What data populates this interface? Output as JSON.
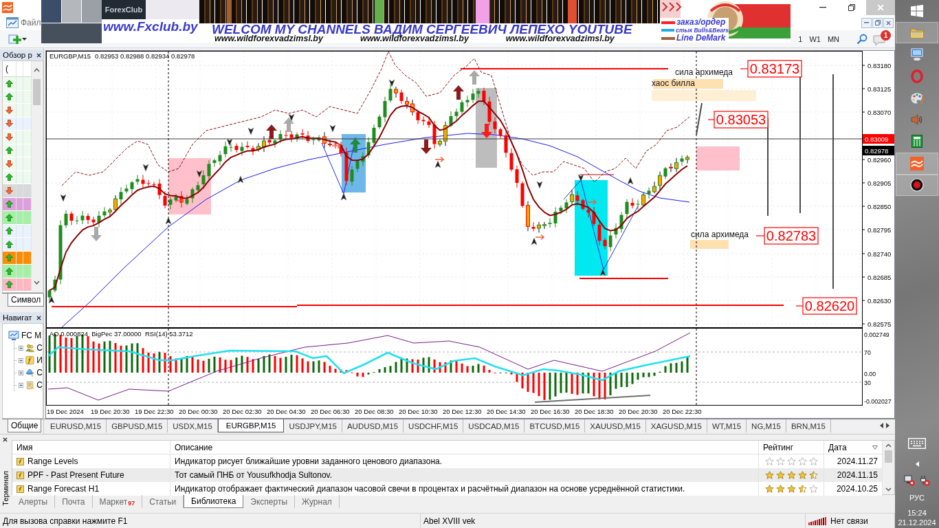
{
  "window": {
    "menu": [
      "Файл"
    ],
    "periods": [
      "1",
      "W1",
      "MN"
    ],
    "notifications": "1"
  },
  "banner": {
    "logo": "ForexClub",
    "site": "www.Fxclub.by",
    "headline": "WELCOM MY CHANNELS ВАДИМ СЕРГЕЕВИЧ ЛЕПЕХО YOUTUBE",
    "links": [
      "www.wildforexvadzimsl.by",
      "www.wildforexvadzimsl.by",
      "www.wildforexvadzimsl.by"
    ],
    "legend": [
      {
        "label": "заказ/ордер",
        "color": "#ff2020"
      },
      {
        "label": "стык Bulls&Bears",
        "color": "#20a8e8"
      },
      {
        "label": "Line DeMark",
        "color": "#a0603c"
      }
    ]
  },
  "market_watch": {
    "title": "Обзор р",
    "column": "(",
    "rows": [
      {
        "kind": "up",
        "color": "#eefaee"
      },
      {
        "kind": "up",
        "color": "#eefaee"
      },
      {
        "kind": "down",
        "color": "#eefaee"
      },
      {
        "kind": "down",
        "color": "#eaf2fb"
      },
      {
        "kind": "down",
        "color": "#eefaee"
      },
      {
        "kind": "up",
        "color": "#eefaee"
      },
      {
        "kind": "down",
        "color": "#eefaee"
      },
      {
        "kind": "up",
        "color": "#eefaee"
      },
      {
        "kind": "down",
        "color": "#d9d9d9"
      },
      {
        "kind": "up",
        "color": "#dda0dd"
      },
      {
        "kind": "up",
        "color": "#a6f0a6"
      },
      {
        "kind": "up",
        "color": "#eaf2fb"
      },
      {
        "kind": "up",
        "color": "#eaf2fb"
      },
      {
        "kind": "up",
        "color": "#ff8c00"
      },
      {
        "kind": "up",
        "color": "#a6f0a6"
      },
      {
        "kind": "up",
        "color": "#ffb6c1"
      }
    ],
    "tab": "Символ"
  },
  "navigator": {
    "title": "Навигат",
    "tree": [
      {
        "label": "FC M",
        "kind": "terminal",
        "children": [
          {
            "label": "С",
            "kind": "accounts",
            "expanded": false
          },
          {
            "label": "И",
            "kind": "indicators",
            "expanded": false
          },
          {
            "label": "С",
            "kind": "experts",
            "expanded": false
          },
          {
            "label": "С",
            "kind": "scripts",
            "expanded": false
          }
        ]
      }
    ],
    "tab": "Общие"
  },
  "chart": {
    "symbol": "EURGBP,M15",
    "quotes": "0.82953 0.82988 0.82934 0.82978",
    "price_axis": [
      "0.83180",
      "0.83125",
      "0.83070",
      "0.82960",
      "0.82905",
      "0.82850",
      "0.82795",
      "0.82740",
      "0.82685",
      "0.82630",
      "0.82575"
    ],
    "price_tags": [
      {
        "text": "0.83009",
        "kind": "line"
      },
      {
        "text": "0.82978",
        "kind": "bid"
      }
    ],
    "annotations": [
      "сила архимеда",
      "хаос билла",
      "сила архимеда"
    ],
    "levels": [
      "0.83173",
      "0.83053",
      "0.82783",
      "0.82620"
    ],
    "indicator": {
      "legend": "AO 0.000824  BigPec 37.00000  RSI(14) 53.3712",
      "axis": [
        "0.002749",
        "70",
        "0.00",
        "30",
        "-0.002027"
      ]
    },
    "time_axis": [
      "19 Dec 2024",
      "19 Dec 20:30",
      "19 Dec 22:30",
      "20 Dec 00:30",
      "20 Dec 02:30",
      "20 Dec 04:30",
      "20 Dec 06:30",
      "20 Dec 08:30",
      "20 Dec 10:30",
      "20 Dec 12:30",
      "20 Dec 14:30",
      "20 Dec 16:30",
      "20 Dec 18:30",
      "20 Dec 20:30",
      "20 Dec 22:30"
    ]
  },
  "chart_tabs": [
    {
      "label": "EURUSD,M15",
      "selected": false
    },
    {
      "label": "GBPUSD,M15",
      "selected": false
    },
    {
      "label": "USDX,M15",
      "selected": false
    },
    {
      "label": "EURGBP,M15",
      "selected": true
    },
    {
      "label": "USDJPY,M15",
      "selected": false
    },
    {
      "label": "AUDUSD,M15",
      "selected": false
    },
    {
      "label": "USDCHF,M15",
      "selected": false
    },
    {
      "label": "USDCAD,M15",
      "selected": false
    },
    {
      "label": "BTCUSD,M15",
      "selected": false
    },
    {
      "label": "XAUUSD,M15",
      "selected": false
    },
    {
      "label": "XAGUSD,M15",
      "selected": false
    },
    {
      "label": "WT,M15",
      "selected": false
    },
    {
      "label": "NG,M15",
      "selected": false
    },
    {
      "label": "BRN,M15",
      "selected": false
    }
  ],
  "terminal": {
    "title": "Терминал",
    "columns": [
      "Имя",
      "Описание",
      "Рейтинг",
      "Дата"
    ],
    "rows": [
      {
        "name": "Range Levels",
        "description": "Индикатор рисует ближайшие уровни заданного ценового диапазона.",
        "stars": 0,
        "date": "2024.11.27"
      },
      {
        "name": "PPF - Past Present Future",
        "description": "Тот самый ПНБ от Yousufkhodja Sultonov.",
        "stars": 4.5,
        "date": "2024.11.15"
      },
      {
        "name": "Range Forecast H1",
        "description": "Индикатор отображает фактический диапазон часовой свечи в процентах и расчётный диапазон на основе усреднённой статистики.",
        "stars": 3.5,
        "date": "2024.10.25"
      }
    ],
    "tabs": [
      {
        "label": "Алерты",
        "selected": false
      },
      {
        "label": "Почта",
        "selected": false
      },
      {
        "label": "Маркет",
        "badge": "97",
        "selected": false
      },
      {
        "label": "Статьи",
        "selected": false
      },
      {
        "label": "Библиотека",
        "selected": true
      },
      {
        "label": "Эксперты",
        "selected": false
      },
      {
        "label": "Журнал",
        "selected": false
      }
    ]
  },
  "status_bar": {
    "help": "Для вызова справки нажмите F1",
    "profile": "Abel XVIII vek",
    "connection": "Нет связи"
  },
  "taskbar": {
    "items": [
      {
        "kind": "start",
        "active": false
      },
      {
        "kind": "folder",
        "active": true
      },
      {
        "kind": "computer",
        "active": false
      },
      {
        "kind": "ring",
        "active": false
      },
      {
        "kind": "palette",
        "active": false
      },
      {
        "kind": "speaker",
        "active": false
      },
      {
        "kind": "calculator",
        "active": false
      },
      {
        "kind": "waves",
        "active": true
      },
      {
        "kind": "record",
        "active": true
      }
    ],
    "language": "РУС",
    "time": "15:24",
    "date": "21.12.2024"
  }
}
